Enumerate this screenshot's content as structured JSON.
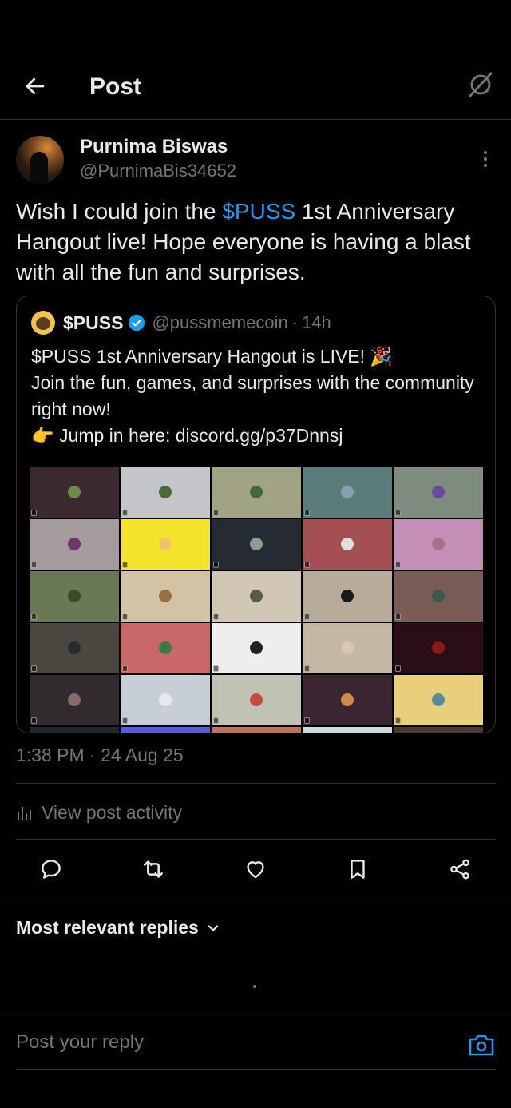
{
  "header": {
    "title": "Post",
    "back_icon": "arrow-left-icon",
    "grok_icon": "grok-icon"
  },
  "post": {
    "author_name": "Purnima Biswas",
    "author_handle": "@PurnimaBis34652",
    "text_before": "Wish I could join the ",
    "cashtag": "$PUSS",
    "text_after": " 1st Anniversary Hangout live! Hope everyone is having a blast with all the fun and surprises.",
    "timestamp": "1:38 PM · 24 Aug 25",
    "view_activity": "View post activity"
  },
  "quote": {
    "name": "$PUSS",
    "handle": "@pussmemecoin",
    "separator": "·",
    "time": "14h",
    "line1": "$PUSS 1st Anniversary Hangout is LIVE! 🎉",
    "line2": "Join the fun, games, and surprises with the community right now!",
    "line3": "👉 Jump in here: discord.gg/p37Dnnsj"
  },
  "actions": {
    "reply_icon": "reply-icon",
    "repost_icon": "repost-icon",
    "like_icon": "heart-icon",
    "bookmark_icon": "bookmark-icon",
    "share_icon": "share-icon"
  },
  "replies": {
    "sort_label": "Most relevant replies"
  },
  "composer": {
    "placeholder": "Post your reply"
  },
  "colors": {
    "accent": "#1d9bf0",
    "text": "#e7e9ea",
    "muted": "#71767b",
    "border": "#2f3336",
    "background": "#000000"
  },
  "video_grid_tiles": [
    {
      "bg": "#3a2a30",
      "av": "#6e8a4a"
    },
    {
      "bg": "#c3c5ca",
      "av": "#4a6a3a"
    },
    {
      "bg": "#a2a385",
      "av": "#3d6b3a"
    },
    {
      "bg": "#5a7d7b",
      "av": "#8aa0b0"
    },
    {
      "bg": "#7e8c7f",
      "av": "#6a4aa0"
    },
    {
      "bg": "#a59a9e",
      "av": "#6b3a6a"
    },
    {
      "bg": "#f3e52a",
      "av": "#f6c070"
    },
    {
      "bg": "#252a33",
      "av": "#8aa08a"
    },
    {
      "bg": "#a44f51",
      "av": "#e0e0e0"
    },
    {
      "bg": "#c38fb6",
      "av": "#a8708a"
    },
    {
      "bg": "#6b7855",
      "av": "#3a4a2a"
    },
    {
      "bg": "#d2c3a5",
      "av": "#9a7040"
    },
    {
      "bg": "#d2c6b5",
      "av": "#5a5a4a"
    },
    {
      "bg": "#b9ab99",
      "av": "#1a1a1a"
    },
    {
      "bg": "#7a5c57",
      "av": "#3a5a4a"
    },
    {
      "bg": "#4a4640",
      "av": "#2a2a2a"
    },
    {
      "bg": "#c86868",
      "av": "#3a7a4a"
    },
    {
      "bg": "#eeeeee",
      "av": "#222222"
    },
    {
      "bg": "#c3b8a4",
      "av": "#d8c8b0"
    },
    {
      "bg": "#2a0e16",
      "av": "#8a1a1a"
    },
    {
      "bg": "#312a2e",
      "av": "#8a6a6a"
    },
    {
      "bg": "#c8ced8",
      "av": "#e8e8f0"
    },
    {
      "bg": "#c1c3b2",
      "av": "#c84a3a"
    },
    {
      "bg": "#3a2530",
      "av": "#d08a4a"
    },
    {
      "bg": "#e7cf7b",
      "av": "#5a8aa0"
    },
    {
      "bg": "#1f2a2a",
      "av": "#1f2a2a"
    },
    {
      "bg": "#5a5ae0",
      "av": "#5a5ae0"
    },
    {
      "bg": "#c0705a",
      "av": "#c0705a"
    },
    {
      "bg": "#c8dcdc",
      "av": "#c8dcdc"
    },
    {
      "bg": "#4a3a30",
      "av": "#4a3a30"
    }
  ]
}
